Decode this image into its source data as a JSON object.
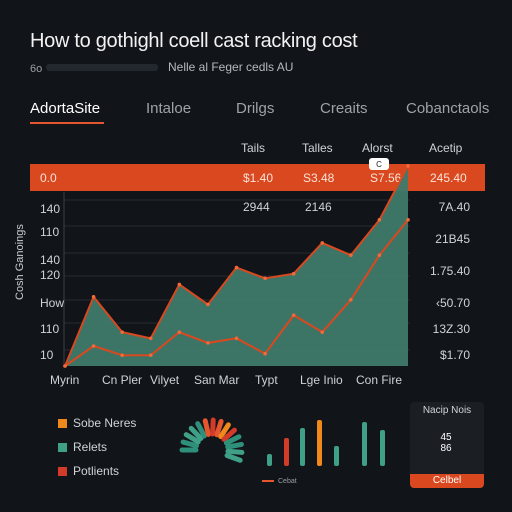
{
  "header": {
    "title": "How to gothighl coell cast racking cost",
    "sub_left": "6o",
    "sub_right": "Nelle al Feger cedls AU"
  },
  "tabs": [
    {
      "label": "AdortaSite",
      "active": true
    },
    {
      "label": "Intaloe",
      "active": false
    },
    {
      "label": "Drilgs",
      "active": false
    },
    {
      "label": "Creaits",
      "active": false
    },
    {
      "label": "Cobanctaols",
      "active": false
    }
  ],
  "table": {
    "col_headers": [
      "Tails",
      "Talles",
      "Alorst",
      "Acetip"
    ],
    "highlight_row": {
      "label": "0.0",
      "values": [
        "$1.40",
        "S3.48",
        "S7.56",
        "245.40"
      ]
    },
    "row2": {
      "values": [
        "2944",
        "2146"
      ]
    },
    "callout": "C"
  },
  "axis": {
    "y_title": "Cosh Ganoings",
    "y_ticks": [
      "140",
      "110",
      "140",
      "120",
      "How",
      "110",
      "10"
    ],
    "right_ticks": [
      "7A.40",
      "21B45",
      "1.75.40",
      "‹50.70",
      "13Z.30",
      "$1.70"
    ],
    "x_labels": [
      "Myrin",
      "Cn Pler",
      "Vilyet",
      "San Mar",
      "Typt",
      "Lge Inio",
      "Con Fire"
    ]
  },
  "legend": [
    {
      "label": "Sobe Neres",
      "color": "#f0891b"
    },
    {
      "label": "Relets",
      "color": "#3fa087"
    },
    {
      "label": "Potlients",
      "color": "#d23a2a"
    }
  ],
  "mini_bars_label": "Cebat",
  "gauge": {
    "title": "Nacip Nois",
    "value_top": "45",
    "value_bottom": "86",
    "footer": "Celbel"
  },
  "chart_data": {
    "type": "area",
    "series": [
      {
        "color": "#3f7a6a",
        "values": [
          0,
          45,
          22,
          18,
          53,
          40,
          64,
          57,
          60,
          80,
          72,
          95,
          130
        ]
      },
      {
        "color": "#d9481f",
        "values": [
          0,
          13,
          7,
          7,
          22,
          15,
          18,
          8,
          33,
          22,
          43,
          72,
          95
        ]
      }
    ]
  }
}
